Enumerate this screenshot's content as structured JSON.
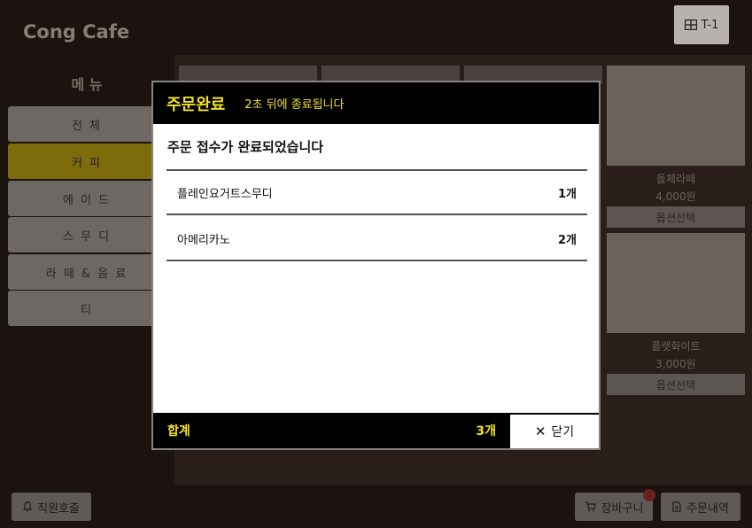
{
  "app": {
    "brand": "Cong Cafe",
    "table": "T-1"
  },
  "menu": {
    "title": "메 뉴",
    "categories": [
      {
        "label": "전 체"
      },
      {
        "label": "커 피"
      },
      {
        "label": "에 이 드"
      },
      {
        "label": "스 무 디"
      },
      {
        "label": "라 떼 & 음 료"
      },
      {
        "label": "티"
      }
    ],
    "active_index": 1
  },
  "products": [
    {
      "name": "돌체라떼",
      "price": "4,000원",
      "option": "옵션선택"
    },
    {
      "name": "플랫화이트",
      "price": "3,000원",
      "option": "옵션선택"
    }
  ],
  "bottom": {
    "staff_call": "직원호출",
    "cart": "장바구니",
    "cart_count": "3",
    "history": "주문내역"
  },
  "modal": {
    "title": "주문완료",
    "countdown": "2초 뒤에 종료됩니다",
    "message": "주문 접수가 완료되었습니다",
    "items": [
      {
        "name": "플레인요거트스무디",
        "qty": "1개"
      },
      {
        "name": "아메리카노",
        "qty": "2개"
      }
    ],
    "total_label": "합계",
    "total_qty": "3개",
    "close_label": "닫기"
  },
  "colors": {
    "accent": "#f3e227",
    "header_bg": "#000000",
    "page_bg": "#1c1210"
  }
}
